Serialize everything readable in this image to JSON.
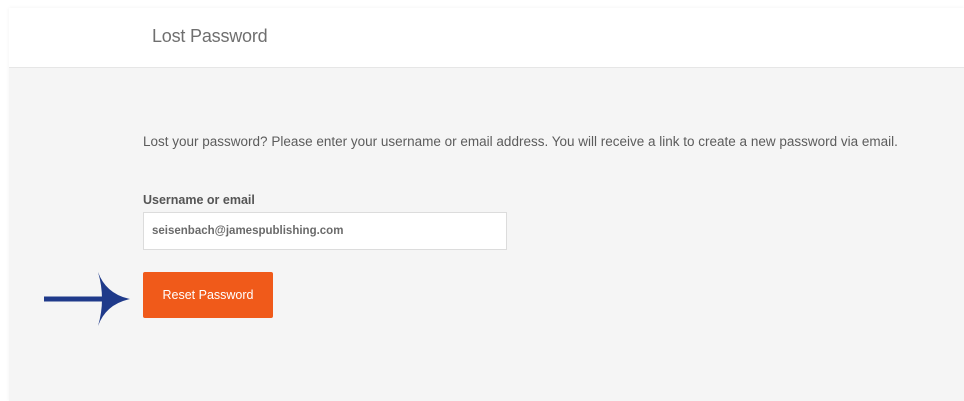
{
  "header": {
    "title": "Lost Password"
  },
  "form": {
    "intro_text": "Lost your password? Please enter your username or email address. You will receive a link to create a new password via email.",
    "username_label": "Username or email",
    "username_value": "seisenbach@jamespublishing.com",
    "submit_label": "Reset Password"
  },
  "annotation": {
    "icon": "arrow-right-icon",
    "color": "#1f3a8a"
  },
  "colors": {
    "button": "#f05a1a",
    "background": "#f5f5f5",
    "header_background": "#ffffff"
  }
}
